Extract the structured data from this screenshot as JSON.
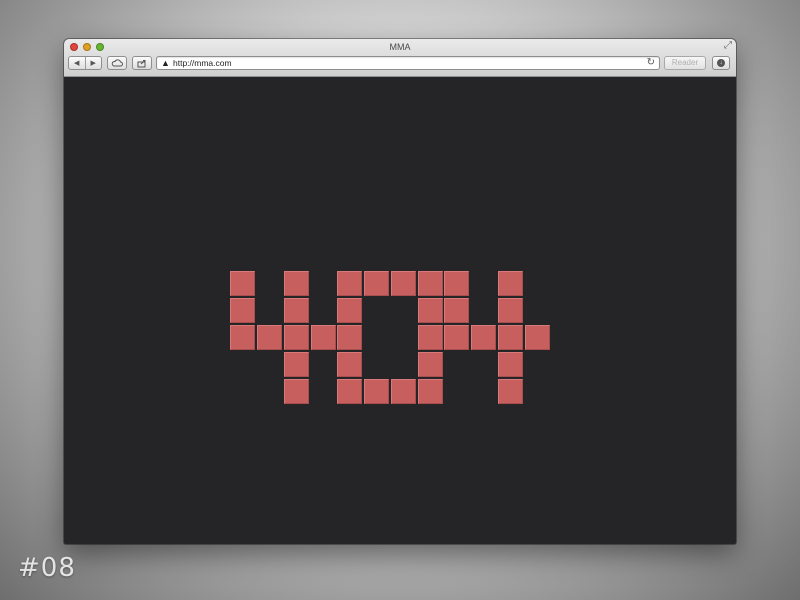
{
  "window": {
    "title": "MMA",
    "traffic_colors": {
      "close": "#e0443e",
      "minimize": "#dea123",
      "maximize": "#65b532"
    }
  },
  "toolbar": {
    "back_icon": "back-arrow-icon",
    "forward_icon": "forward-arrow-icon",
    "icloud_icon": "cloud-icon",
    "share_icon": "share-icon",
    "url": "http://mma.com",
    "reload_icon": "reload-icon",
    "reader_label": "Reader",
    "downloads_icon": "download-icon"
  },
  "page": {
    "background": "#252528",
    "error_code": "404",
    "tile_color": "#c75f5f",
    "glyphs": {
      "4": [
        "1010",
        "1010",
        "1111",
        "0010",
        "0010"
      ],
      "0": [
        "1111",
        "1001",
        "1001",
        "1001",
        "1111"
      ]
    }
  },
  "caption": "#08"
}
